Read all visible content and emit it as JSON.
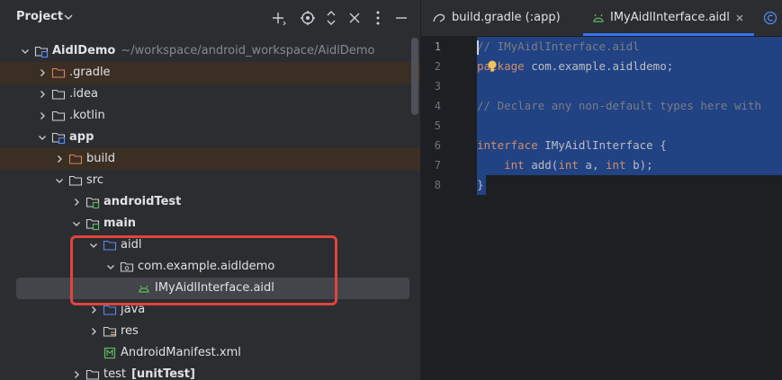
{
  "project_panel": {
    "title": "Project",
    "toolbar": [
      "add-icon",
      "locate-icon",
      "expand-collapse-icon",
      "close-icon",
      "more-icon",
      "minimize-icon"
    ]
  },
  "tree": [
    {
      "label": "AidlDemo",
      "path": "~/workspace/android_workspace/AidlDemo",
      "indent": 0,
      "expanded": true,
      "icon": "module",
      "bold": true
    },
    {
      "label": ".gradle",
      "indent": 1,
      "expanded": false,
      "icon": "folder-excluded",
      "highlight": true
    },
    {
      "label": ".idea",
      "indent": 1,
      "expanded": false,
      "icon": "folder"
    },
    {
      "label": ".kotlin",
      "indent": 1,
      "expanded": false,
      "icon": "folder"
    },
    {
      "label": "app",
      "indent": 1,
      "expanded": true,
      "icon": "module",
      "bold": true
    },
    {
      "label": "build",
      "indent": 2,
      "expanded": false,
      "icon": "folder-excluded",
      "highlight": true
    },
    {
      "label": "src",
      "indent": 2,
      "expanded": true,
      "icon": "folder"
    },
    {
      "label": "androidTest",
      "indent": 3,
      "expanded": false,
      "icon": "folder-test",
      "bold": true
    },
    {
      "label": "main",
      "indent": 3,
      "expanded": true,
      "icon": "folder-test",
      "bold": true
    },
    {
      "label": "aidl",
      "indent": 4,
      "expanded": true,
      "icon": "folder-source"
    },
    {
      "label": "com.example.aidldemo",
      "indent": 5,
      "expanded": true,
      "icon": "package"
    },
    {
      "label": "IMyAidlInterface.aidl",
      "indent": 6,
      "icon": "aidl-file",
      "selected": true
    },
    {
      "label": "java",
      "indent": 4,
      "expanded": false,
      "icon": "folder-source"
    },
    {
      "label": "res",
      "indent": 4,
      "expanded": false,
      "icon": "folder-res"
    },
    {
      "label": "AndroidManifest.xml",
      "indent": 4,
      "icon": "manifest-file"
    },
    {
      "label": "test",
      "tag": "[unitTest]",
      "indent": 3,
      "expanded": false,
      "icon": "folder"
    }
  ],
  "tabs": [
    {
      "label": "build.gradle (:app)",
      "icon": "gradle-icon",
      "active": false
    },
    {
      "label": "IMyAidlInterface.aidl",
      "icon": "android-icon",
      "active": true,
      "closable": true
    },
    {
      "label": "",
      "icon": "class-icon",
      "active": false
    }
  ],
  "editor": {
    "line_numbers": [
      "1",
      "2",
      "3",
      "4",
      "5",
      "6",
      "7",
      "8"
    ],
    "current_line": "1",
    "lines": [
      [
        {
          "t": "// IMyAidlInterface.aidl",
          "c": "c-com"
        }
      ],
      [
        {
          "t": "package",
          "c": "c-kw"
        },
        {
          "t": " com.example.aidldemo;",
          "c": "c-id"
        }
      ],
      [],
      [
        {
          "t": "// Declare any non-default types here with",
          "c": "c-com"
        }
      ],
      [],
      [
        {
          "t": "interface",
          "c": "c-kw"
        },
        {
          "t": " IMyAidlInterface {",
          "c": "c-id"
        }
      ],
      [
        {
          "t": "    ",
          "c": "c-id"
        },
        {
          "t": "int",
          "c": "c-kw"
        },
        {
          "t": " ",
          "c": "c-id"
        },
        {
          "t": "add",
          "c": "c-id"
        },
        {
          "t": "(",
          "c": "c-id"
        },
        {
          "t": "int",
          "c": "c-kw"
        },
        {
          "t": " a, ",
          "c": "c-id"
        },
        {
          "t": "int",
          "c": "c-kw"
        },
        {
          "t": " b);",
          "c": "c-id"
        }
      ],
      [
        {
          "t": "}",
          "c": "c-id"
        }
      ]
    ]
  },
  "colors": {
    "selection": "#214283",
    "highlight_annotation": "#e0443e",
    "accent": "#3574f0"
  }
}
